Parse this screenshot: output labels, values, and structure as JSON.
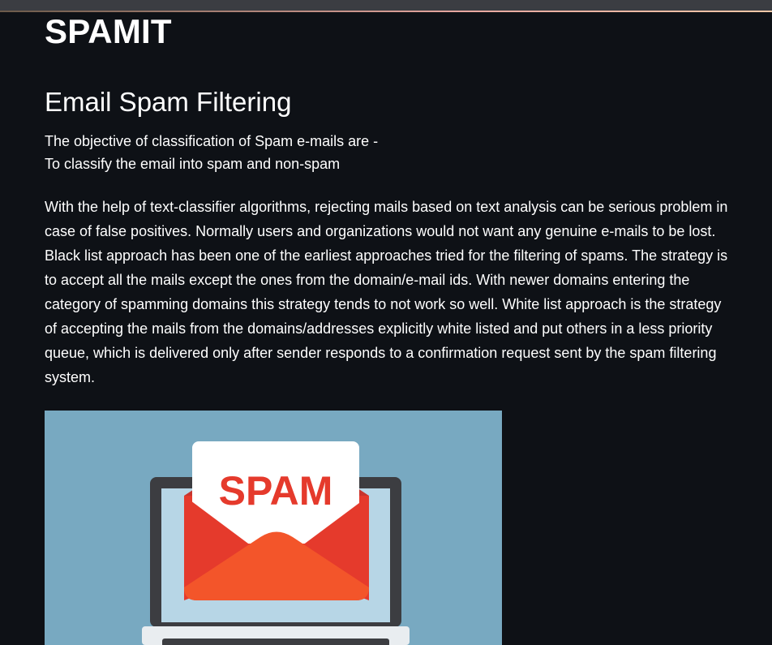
{
  "header": {
    "brand": "SPAMIT"
  },
  "section": {
    "title": "Email Spam Filtering",
    "objective_line1": "The objective of classification of Spam e-mails are -",
    "objective_line2": "To classify the email into spam and non-spam",
    "paragraph": "With the help of text-classifier algorithms, rejecting mails based on text analysis can be serious problem in case of false positives. Normally users and organizations would not want any genuine e-mails to be lost. Black list approach has been one of the earliest approaches tried for the filtering of spams. The strategy is to accept all the mails except the ones from the domain/e-mail ids. With newer domains entering the category of spamming domains this strategy tends to not work so well. White list approach is the strategy of accepting the mails from the domains/addresses explicitly white listed and put others in a less priority queue, which is delivered only after sender responds to a confirmation request sent by the spam filtering system."
  },
  "illustration": {
    "label": "SPAM",
    "background": "#78a9c1",
    "envelope_color": "#e53a2c",
    "flap_color": "#f3552a",
    "screen_color": "#b7d6e6",
    "frame_color": "#3c3d41"
  }
}
